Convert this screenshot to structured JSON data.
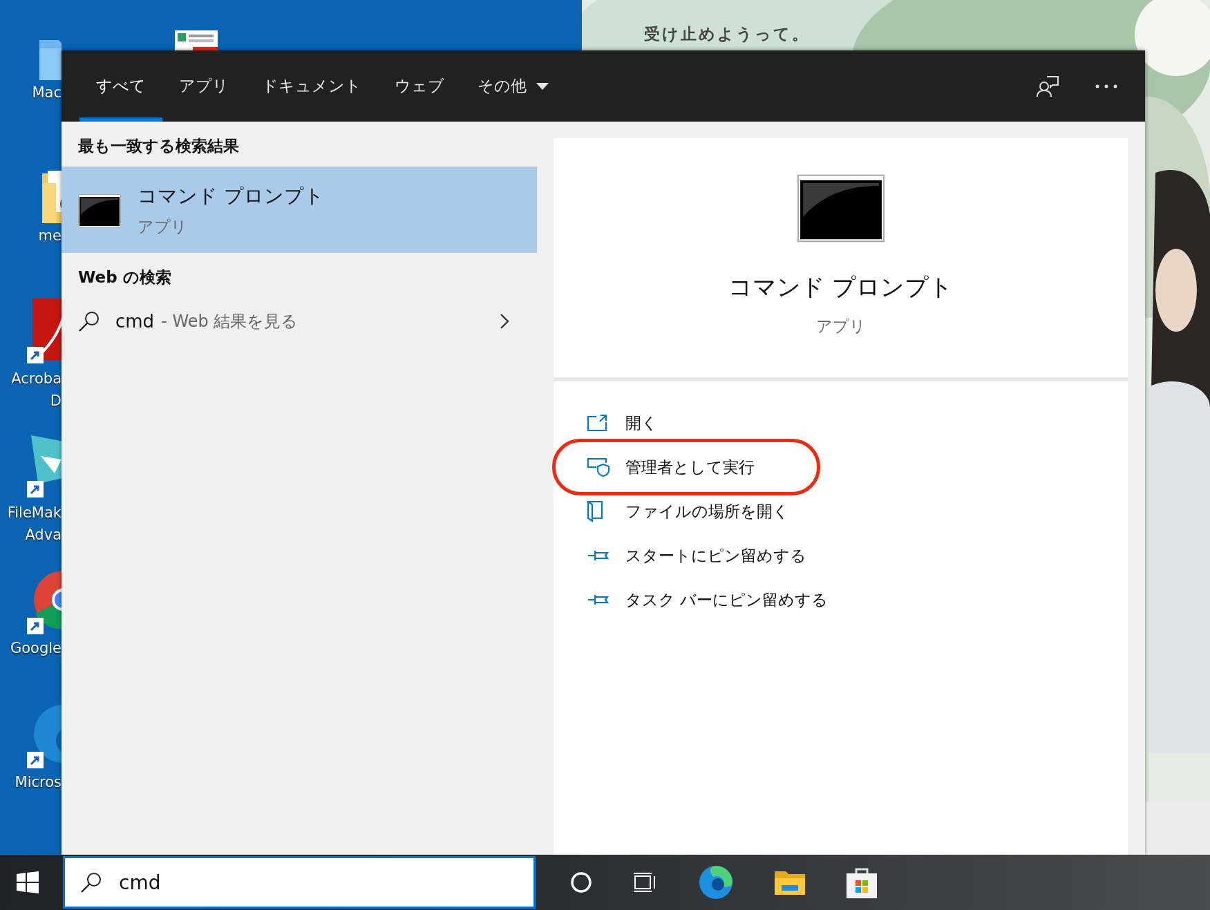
{
  "desktop": {
    "icons": [
      {
        "kind": "folder",
        "lines": [
          "Mac"
        ]
      },
      {
        "kind": "doc-folder",
        "lines": [
          "me"
        ]
      },
      {
        "kind": "acrobat",
        "lines": [
          "Acroba",
          "D"
        ]
      },
      {
        "kind": "filemaker",
        "lines": [
          "FileMak",
          "Adva"
        ]
      },
      {
        "kind": "chrome",
        "lines": [
          "Google"
        ]
      },
      {
        "kind": "edge",
        "lines": [
          "Micros"
        ]
      }
    ]
  },
  "background_page": {
    "caption": "受け止めようって。"
  },
  "search_panel": {
    "tabs": [
      {
        "label": "すべて",
        "selected": true,
        "has_menu": false
      },
      {
        "label": "アプリ",
        "selected": false,
        "has_menu": false
      },
      {
        "label": "ドキュメント",
        "selected": false,
        "has_menu": false
      },
      {
        "label": "ウェブ",
        "selected": false,
        "has_menu": false
      },
      {
        "label": "その他",
        "selected": false,
        "has_menu": true
      }
    ],
    "best_match": {
      "heading": "最も一致する検索結果",
      "title": "コマンド プロンプト",
      "subtitle": "アプリ",
      "selected": true
    },
    "web_search": {
      "heading": "Web の検索",
      "query": "cmd",
      "suffix": "- Web 結果を見る"
    },
    "detail": {
      "title": "コマンド プロンプト",
      "subtitle": "アプリ",
      "actions": [
        {
          "kind": "open",
          "label": "開く",
          "circled": false
        },
        {
          "kind": "admin",
          "label": "管理者として実行",
          "circled": true
        },
        {
          "kind": "folder",
          "label": "ファイルの場所を開く",
          "circled": false
        },
        {
          "kind": "pin",
          "label": "スタートにピン留めする",
          "circled": false
        },
        {
          "kind": "pin",
          "label": "タスク バーにピン留めする",
          "circled": false
        }
      ]
    }
  },
  "taskbar": {
    "search": {
      "value": "cmd"
    }
  }
}
